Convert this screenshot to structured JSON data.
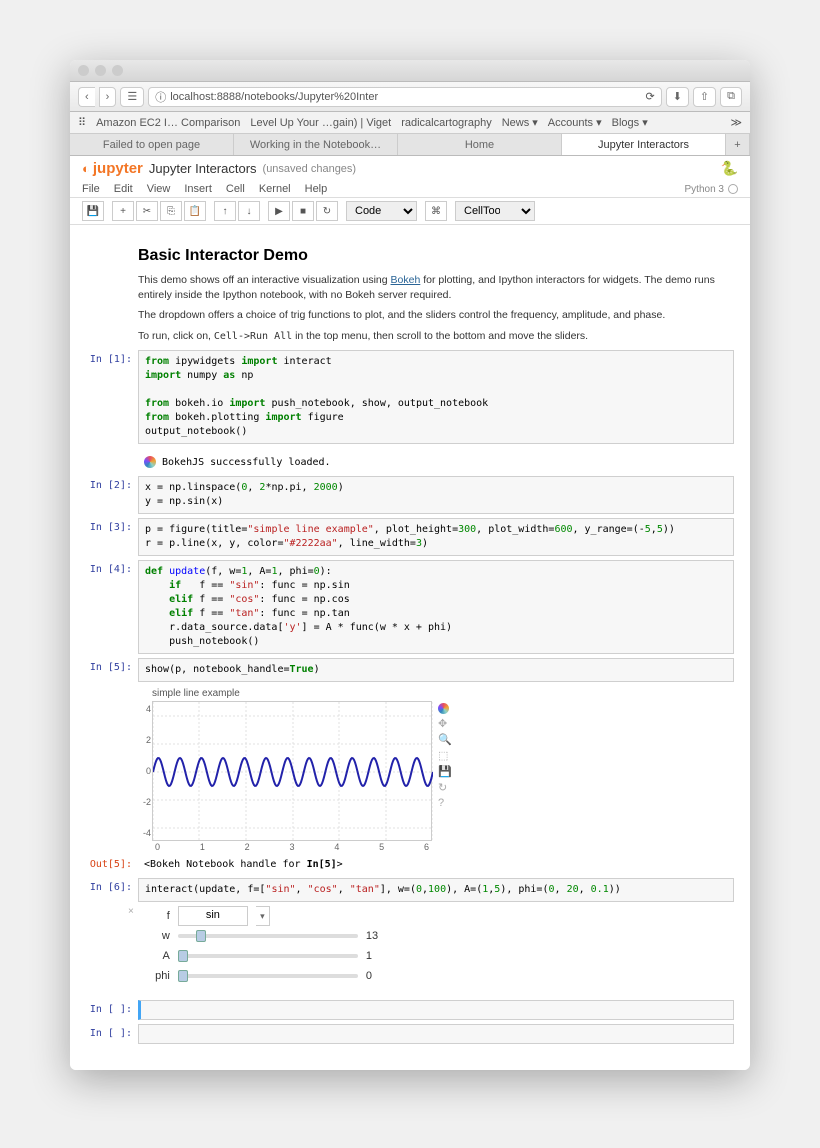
{
  "browser": {
    "url": "localhost:8888/notebooks/Jupyter%20Inter",
    "favs": [
      "Amazon EC2 I… Comparison",
      "Level Up Your …gain) | Viget",
      "radicalcartography",
      "News ▾",
      "Accounts ▾",
      "Blogs ▾"
    ],
    "tabs": [
      "Failed to open page",
      "Working in the Notebook…",
      "Home",
      "Jupyter Interactors"
    ]
  },
  "header": {
    "logo": "jupyter",
    "title": "Jupyter Interactors",
    "status": "(unsaved changes)",
    "kernel": "Python 3"
  },
  "menu": [
    "File",
    "Edit",
    "View",
    "Insert",
    "Cell",
    "Kernel",
    "Help"
  ],
  "toolbar": {
    "celltype": "Code",
    "celltoolbar": "CellToolbar"
  },
  "markdown": {
    "title": "Basic Interactor Demo",
    "p1a": "This demo shows off an interactive visualization using ",
    "p1link": "Bokeh",
    "p1b": " for plotting, and Ipython interactors for widgets. The demo runs entirely inside the Ipython notebook, with no Bokeh server required.",
    "p2": "The dropdown offers a choice of trig functions to plot, and the sliders control the frequency, amplitude, and phase.",
    "p3a": "To run, click on, ",
    "p3code": "Cell->Run All",
    "p3b": " in the top menu, then scroll to the bottom and move the sliders."
  },
  "cells": {
    "c1_prompt": "In [1]:",
    "c2_prompt": "In [2]:",
    "c3_prompt": "In [3]:",
    "c4_prompt": "In [4]:",
    "c5_prompt": "In [5]:",
    "c6_prompt": "In [6]:",
    "out5_prompt": "Out[5]:",
    "empty_prompt": "In [ ]:",
    "bokeh_msg": "BokehJS successfully loaded.",
    "out5_text": "<Bokeh Notebook handle for In[5]>"
  },
  "plot": {
    "title": "simple line example",
    "yticks": [
      "4",
      "2",
      "0",
      "-2",
      "-4"
    ],
    "xticks": [
      "0",
      "1",
      "2",
      "3",
      "4",
      "5",
      "6"
    ]
  },
  "widgets": {
    "f_label": "f",
    "f_value": "sin",
    "w_label": "w",
    "w_value": "13",
    "A_label": "A",
    "A_value": "1",
    "phi_label": "phi",
    "phi_value": "0"
  },
  "chart_data": {
    "type": "line",
    "title": "simple line example",
    "xlabel": "",
    "ylabel": "",
    "xlim": [
      0,
      6.3
    ],
    "ylim": [
      -5,
      5
    ],
    "x": [
      0,
      0.5,
      1.0,
      1.5,
      2.0,
      2.5,
      3.0,
      3.5,
      4.0,
      4.5,
      5.0,
      5.5,
      6.0,
      6.28
    ],
    "y": [
      0,
      0.74,
      -0.84,
      0.2,
      0.57,
      -0.98,
      0.53,
      0.37,
      -0.99,
      0.71,
      0.16,
      -0.95,
      0.84,
      -0.03
    ],
    "series_name": "sin(13x)",
    "frequency": 13,
    "amplitude": 1,
    "phase": 0
  }
}
